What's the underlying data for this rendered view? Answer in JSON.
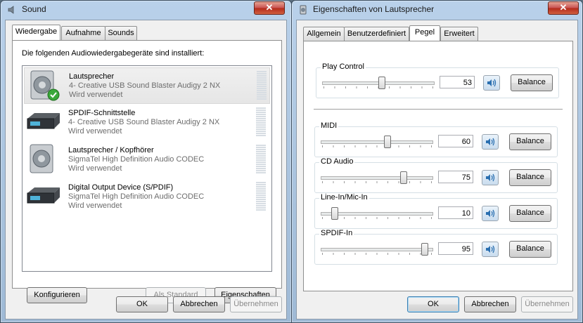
{
  "sound": {
    "title": "Sound",
    "tabs": [
      "Wiedergabe",
      "Aufnahme",
      "Sounds"
    ],
    "intro": "Die folgenden Audiowiedergabegeräte sind installiert:",
    "devices": [
      {
        "name": "Lautsprecher",
        "driver": "4- Creative USB Sound Blaster Audigy 2 NX",
        "status": "Wird verwendet",
        "icon": "speaker-default-icon"
      },
      {
        "name": "SPDIF-Schnittstelle",
        "driver": "4- Creative USB Sound Blaster Audigy 2 NX",
        "status": "Wird verwendet",
        "icon": "receiver-icon"
      },
      {
        "name": "Lautsprecher / Kopfhörer",
        "driver": "SigmaTel High Definition Audio CODEC",
        "status": "Wird verwendet",
        "icon": "speaker-icon"
      },
      {
        "name": "Digital Output Device (S/PDIF)",
        "driver": "SigmaTel High Definition Audio CODEC",
        "status": "Wird verwendet",
        "icon": "receiver-icon"
      }
    ],
    "buttons": {
      "configure": "Konfigurieren",
      "set_default": "Als Standard",
      "properties": "Eigenschaften",
      "ok": "OK",
      "cancel": "Abbrechen",
      "apply": "Übernehmen"
    }
  },
  "props": {
    "title": "Eigenschaften von Lautsprecher",
    "tabs": [
      "Allgemein",
      "Benutzerdefiniert",
      "Pegel",
      "Erweitert"
    ],
    "master": {
      "label": "Play Control",
      "value": 53
    },
    "channels": [
      {
        "label": "MIDI",
        "value": 60
      },
      {
        "label": "CD Audio",
        "value": 75
      },
      {
        "label": "Line-In/Mic-In",
        "value": 10
      },
      {
        "label": "SPDIF-In",
        "value": 95
      }
    ],
    "balance_label": "Balance",
    "buttons": {
      "ok": "OK",
      "cancel": "Abbrechen",
      "apply": "Übernehmen"
    }
  },
  "colors": {
    "accent": "#3c7fb1",
    "title_bar": "#b9d1ea",
    "window_bg": "#f0f0f0"
  }
}
